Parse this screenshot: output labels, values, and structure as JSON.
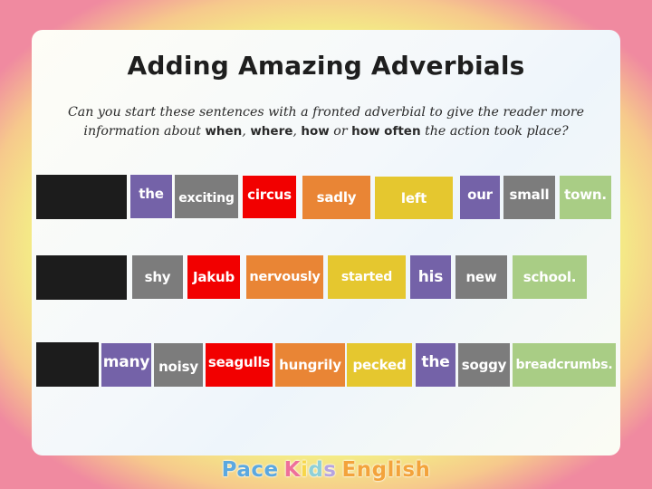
{
  "slide": {
    "title": "Adding Amazing Adverbials",
    "instruction": {
      "line1": "Can you start these sentences with a fronted adverbial to give the reader more",
      "line2_prefix": "information about ",
      "when": "when",
      "sep1": ", ",
      "where": "where",
      "sep2": ", ",
      "how": "how",
      "or": " or ",
      "how_often": "how often",
      "line2_suffix": " the action took place?"
    }
  },
  "colors": {
    "determiner": "#7462a8",
    "adjective": "#7c7c7c",
    "noun": "#f20000",
    "adverb": "#e98535",
    "verb": "#e5c72f",
    "ending": "#a9cd85",
    "blank": "#1c1c1c"
  },
  "sentences": [
    {
      "words": [
        "the",
        "exciting",
        "circus",
        "sadly",
        "left",
        "our",
        "small",
        "town."
      ]
    },
    {
      "words": [
        "shy",
        "Jakub",
        "nervously",
        "started",
        "his",
        "new",
        "school."
      ]
    },
    {
      "words": [
        "many",
        "noisy",
        "seagulls",
        "hungrily",
        "pecked",
        "the",
        "soggy",
        "breadcrumbs."
      ]
    }
  ],
  "logo": {
    "pace": "Pace",
    "kids_k": "K",
    "kids_i": "i",
    "kids_d": "d",
    "kids_s": "s",
    "english": "English"
  }
}
